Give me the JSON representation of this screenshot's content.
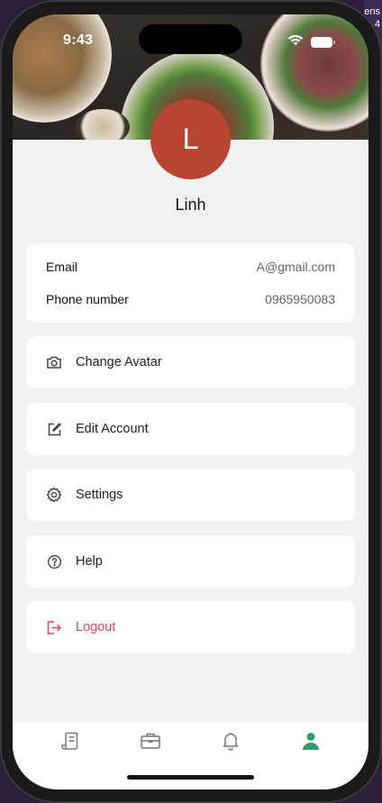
{
  "desktop": {
    "edge_text": "ens .4"
  },
  "status_bar": {
    "time": "9:43"
  },
  "profile": {
    "avatar_initial": "L",
    "avatar_color": "#b84432",
    "name": "Linh"
  },
  "contact": {
    "email_label": "Email",
    "email_value": "A@gmail.com",
    "phone_label": "Phone number",
    "phone_value": "0965950083"
  },
  "menu": [
    {
      "label": "Change Avatar",
      "icon": "camera-icon"
    },
    {
      "label": "Edit Account",
      "icon": "edit-icon"
    },
    {
      "label": "Settings",
      "icon": "gear-icon"
    },
    {
      "label": "Help",
      "icon": "help-circle-icon"
    },
    {
      "label": "Logout",
      "icon": "logout-icon"
    }
  ],
  "colors": {
    "accent": "#2e9e6e",
    "logout": "#e0455a",
    "icon_gray": "#777777"
  },
  "tab_bar": [
    {
      "icon": "receipt-icon",
      "active": false
    },
    {
      "icon": "briefcase-icon",
      "active": false
    },
    {
      "icon": "bell-icon",
      "active": false
    },
    {
      "icon": "user-icon",
      "active": true
    }
  ]
}
